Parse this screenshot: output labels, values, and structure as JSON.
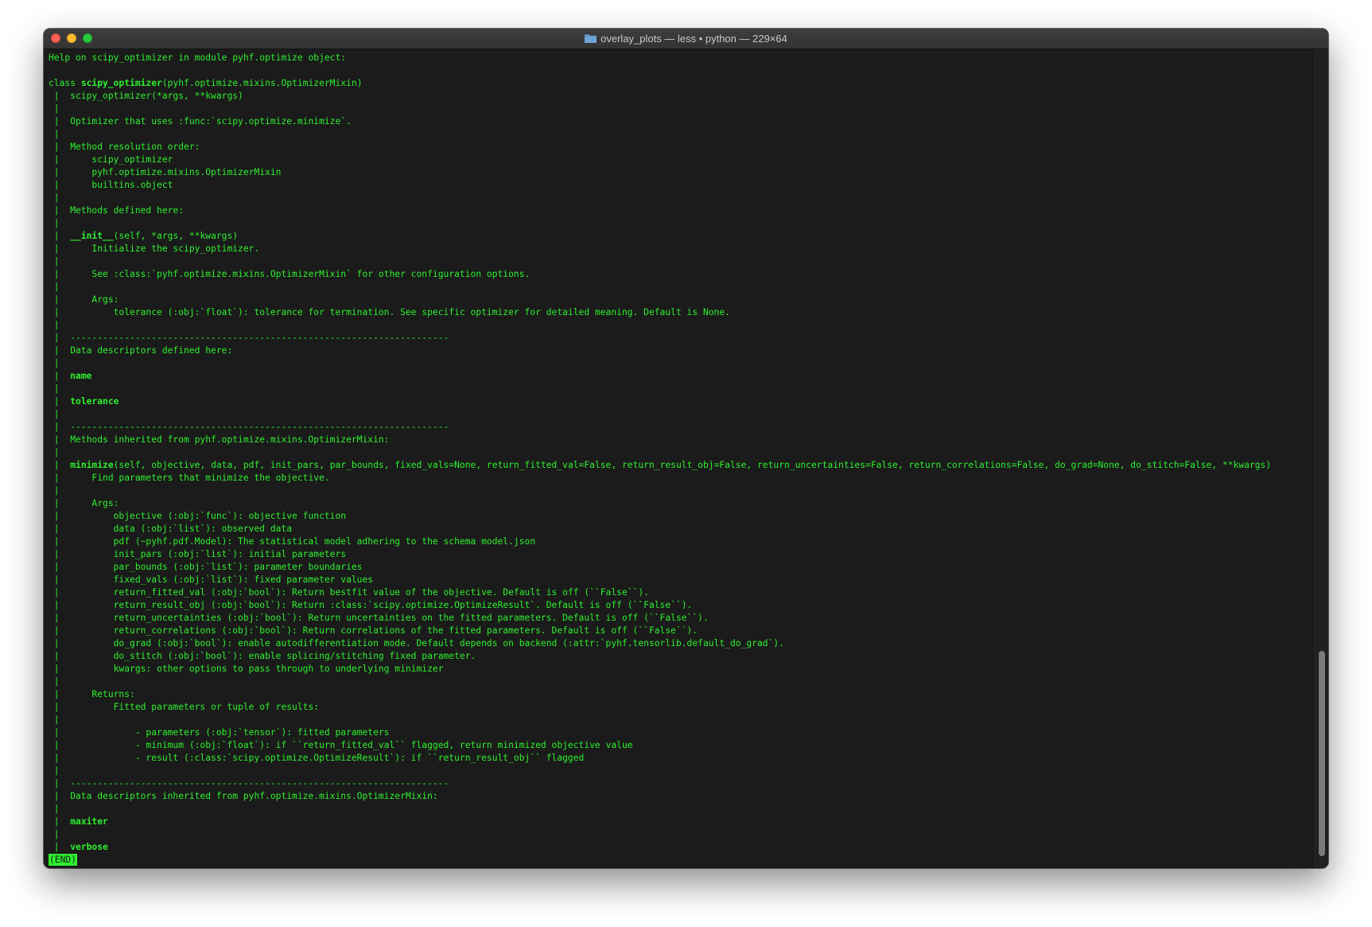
{
  "window": {
    "title": "overlay_plots — less • python — 229×64",
    "folder_icon": "folder-icon",
    "colors": {
      "background": "#1b1b1b",
      "text": "#2ef02e"
    }
  },
  "terminal": {
    "lines": [
      {
        "text": "Help on scipy_optimizer in module pyhf.optimize object:"
      },
      {
        "text": ""
      },
      {
        "pre": "class ",
        "bold": "scipy_optimizer",
        "post": "(pyhf.optimize.mixins.OptimizerMixin)"
      },
      {
        "text": " |  scipy_optimizer(*args, **kwargs)"
      },
      {
        "text": " |"
      },
      {
        "text": " |  Optimizer that uses :func:`scipy.optimize.minimize`."
      },
      {
        "text": " |"
      },
      {
        "text": " |  Method resolution order:"
      },
      {
        "text": " |      scipy_optimizer"
      },
      {
        "text": " |      pyhf.optimize.mixins.OptimizerMixin"
      },
      {
        "text": " |      builtins.object"
      },
      {
        "text": " |"
      },
      {
        "text": " |  Methods defined here:"
      },
      {
        "text": " |"
      },
      {
        "pre": " |  ",
        "bold": "__init__",
        "post": "(self, *args, **kwargs)"
      },
      {
        "text": " |      Initialize the scipy_optimizer."
      },
      {
        "text": " |"
      },
      {
        "text": " |      See :class:`pyhf.optimize.mixins.OptimizerMixin` for other configuration options."
      },
      {
        "text": " |"
      },
      {
        "text": " |      Args:"
      },
      {
        "text": " |          tolerance (:obj:`float`): tolerance for termination. See specific optimizer for detailed meaning. Default is None."
      },
      {
        "text": " |"
      },
      {
        "text": " |  ----------------------------------------------------------------------"
      },
      {
        "text": " |  Data descriptors defined here:"
      },
      {
        "text": " |"
      },
      {
        "pre": " |  ",
        "bold": "name",
        "post": ""
      },
      {
        "text": " |"
      },
      {
        "pre": " |  ",
        "bold": "tolerance",
        "post": ""
      },
      {
        "text": " |"
      },
      {
        "text": " |  ----------------------------------------------------------------------"
      },
      {
        "text": " |  Methods inherited from pyhf.optimize.mixins.OptimizerMixin:"
      },
      {
        "text": " |"
      },
      {
        "pre": " |  ",
        "bold": "minimize",
        "post": "(self, objective, data, pdf, init_pars, par_bounds, fixed_vals=None, return_fitted_val=False, return_result_obj=False, return_uncertainties=False, return_correlations=False, do_grad=None, do_stitch=False, **kwargs)"
      },
      {
        "text": " |      Find parameters that minimize the objective."
      },
      {
        "text": " |"
      },
      {
        "text": " |      Args:"
      },
      {
        "text": " |          objective (:obj:`func`): objective function"
      },
      {
        "text": " |          data (:obj:`list`): observed data"
      },
      {
        "text": " |          pdf (~pyhf.pdf.Model): The statistical model adhering to the schema model.json"
      },
      {
        "text": " |          init_pars (:obj:`list`): initial parameters"
      },
      {
        "text": " |          par_bounds (:obj:`list`): parameter boundaries"
      },
      {
        "text": " |          fixed_vals (:obj:`list`): fixed parameter values"
      },
      {
        "text": " |          return_fitted_val (:obj:`bool`): Return bestfit value of the objective. Default is off (``False``)."
      },
      {
        "text": " |          return_result_obj (:obj:`bool`): Return :class:`scipy.optimize.OptimizeResult`. Default is off (``False``)."
      },
      {
        "text": " |          return_uncertainties (:obj:`bool`): Return uncertainties on the fitted parameters. Default is off (``False``)."
      },
      {
        "text": " |          return_correlations (:obj:`bool`): Return correlations of the fitted parameters. Default is off (``False``)."
      },
      {
        "text": " |          do_grad (:obj:`bool`): enable autodifferentiation mode. Default depends on backend (:attr:`pyhf.tensorlib.default_do_grad`)."
      },
      {
        "text": " |          do_stitch (:obj:`bool`): enable splicing/stitching fixed parameter."
      },
      {
        "text": " |          kwargs: other options to pass through to underlying minimizer"
      },
      {
        "text": " |"
      },
      {
        "text": " |      Returns:"
      },
      {
        "text": " |          Fitted parameters or tuple of results:"
      },
      {
        "text": " |"
      },
      {
        "text": " |              - parameters (:obj:`tensor`): fitted parameters"
      },
      {
        "text": " |              - minimum (:obj:`float`): if ``return_fitted_val`` flagged, return minimized objective value"
      },
      {
        "text": " |              - result (:class:`scipy.optimize.OptimizeResult`): if ``return_result_obj`` flagged"
      },
      {
        "text": " |"
      },
      {
        "text": " |  ----------------------------------------------------------------------"
      },
      {
        "text": " |  Data descriptors inherited from pyhf.optimize.mixins.OptimizerMixin:"
      },
      {
        "text": " |"
      },
      {
        "pre": " |  ",
        "bold": "maxiter",
        "post": ""
      },
      {
        "text": " |"
      },
      {
        "pre": " |  ",
        "bold": "verbose",
        "post": ""
      }
    ],
    "end_marker": "(END)"
  },
  "scrollbar": {
    "position_fraction": 0.735
  }
}
